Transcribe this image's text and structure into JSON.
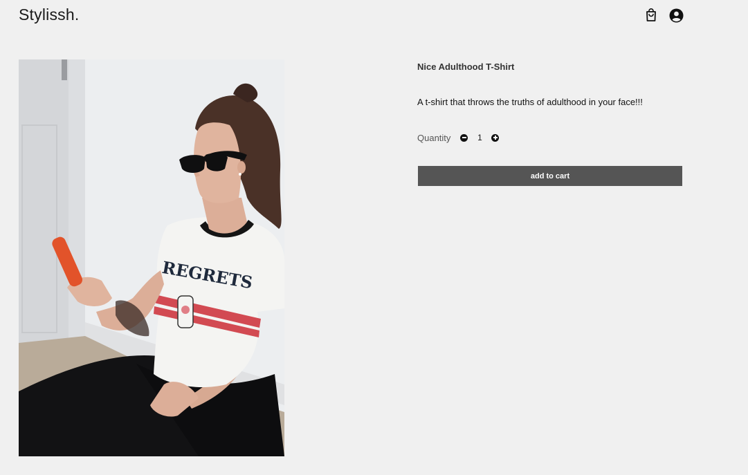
{
  "header": {
    "logo": "Stylissh.",
    "cart_icon": "shopping-bag-icon",
    "account_icon": "user-circle-icon"
  },
  "product": {
    "image_alt": "Woman in sunglasses wearing a Regrets t-shirt, looking at a phone",
    "image_shirt_text": "REGRETS",
    "title": "Nice Adulthood T-Shirt",
    "description": "A t-shirt that throws the truths of adulthood in your face!!!",
    "quantity_label": "Quantity",
    "quantity_value": "1",
    "decrement_icon": "minus-circle-icon",
    "increment_icon": "plus-circle-icon",
    "add_to_cart_label": "add to cart"
  },
  "colors": {
    "background": "#f0f0f0",
    "button": "#555555",
    "button_text": "#ffffff"
  }
}
